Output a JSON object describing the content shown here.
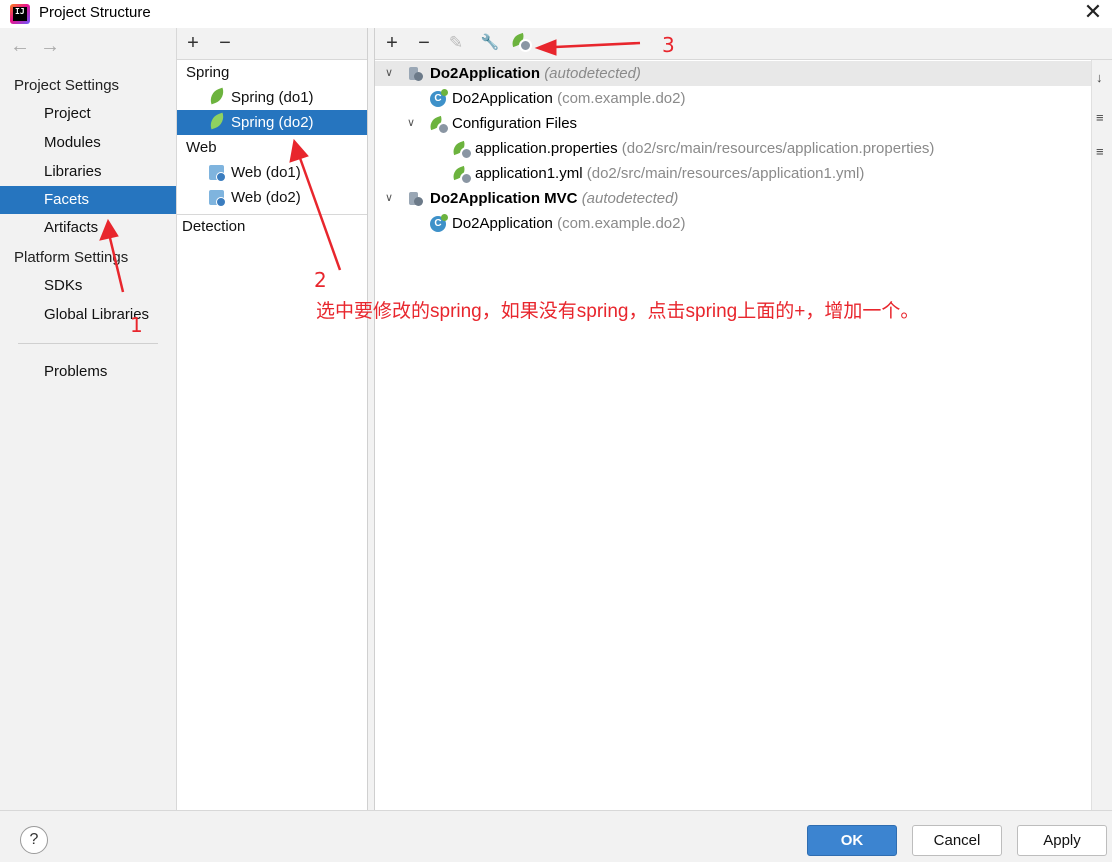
{
  "window": {
    "title": "Project Structure",
    "app_icon_text": "IJ",
    "close_glyph": "✕"
  },
  "nav": {
    "back": "←",
    "forward": "→"
  },
  "sidebar": {
    "project_settings_header": "Project Settings",
    "project_items": [
      "Project",
      "Modules",
      "Libraries",
      "Facets",
      "Artifacts"
    ],
    "selected": "Facets",
    "platform_settings_header": "Platform Settings",
    "platform_items": [
      "SDKs",
      "Global Libraries"
    ],
    "problems": "Problems"
  },
  "facets_list": {
    "add": "+",
    "remove": "−",
    "groups": [
      {
        "name": "Spring",
        "items": [
          "Spring (do1)",
          "Spring (do2)"
        ]
      },
      {
        "name": "Web",
        "items": [
          "Web (do1)",
          "Web (do2)"
        ]
      }
    ],
    "selected": "Spring (do2)",
    "detection": "Detection"
  },
  "right_toolbar": {
    "add": "+",
    "remove": "−",
    "edit": "✎",
    "wrench": "🔧"
  },
  "tree": {
    "node1": {
      "name": "Do2Application",
      "tag": "(autodetected)"
    },
    "node1_child1": {
      "name": "Do2Application",
      "pkg": "(com.example.do2)"
    },
    "node1_config": {
      "name": "Configuration Files"
    },
    "config_file1": {
      "name": "application.properties",
      "path": "(do2/src/main/resources/application.properties)"
    },
    "config_file2": {
      "name": "application1.yml",
      "path": "(do2/src/main/resources/application1.yml)"
    },
    "node2": {
      "name": "Do2Application MVC",
      "tag": "(autodetected)"
    },
    "node2_child1": {
      "name": "Do2Application",
      "pkg": "(com.example.do2)"
    }
  },
  "annotations": {
    "n1": "1",
    "n2": "2",
    "n3": "3",
    "instruction": "选中要修改的spring，如果没有spring，点击spring上面的+，增加一个。"
  },
  "buttons": {
    "help": "?",
    "ok": "OK",
    "cancel": "Cancel",
    "apply": "Apply"
  },
  "colors": {
    "selection": "#2675bf",
    "annotation": "#e8262d",
    "spring_green": "#6cb33e"
  }
}
